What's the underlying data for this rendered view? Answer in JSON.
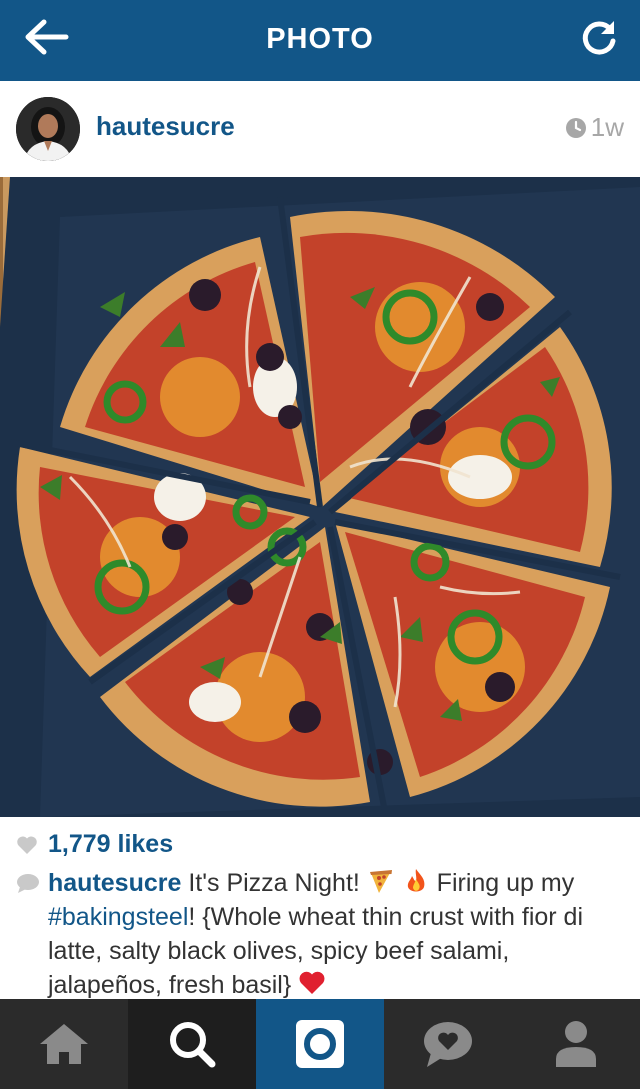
{
  "app": {
    "screen_title": "PHOTO",
    "colors": {
      "brand_blue": "#125688",
      "tabbar": "#2b2b2b",
      "muted": "#a7a7a7"
    }
  },
  "icons": {
    "back": "arrow-left-icon",
    "refresh": "refresh-icon",
    "clock": "clock-icon",
    "like": "heart-icon",
    "comment": "comment-bubble-icon",
    "tabs": [
      "home-icon",
      "search-icon",
      "camera-icon",
      "activity-icon",
      "profile-icon"
    ]
  },
  "post": {
    "username": "hautesucre",
    "time_ago": "1w",
    "likes": "1,779 likes",
    "caption": {
      "user": "hautesucre",
      "part1": " It's Pizza Night! ",
      "part2": " Firing up my ",
      "hashtag": "#bakingsteel",
      "part3": "! {Whole wheat thin crust with fior di latte, salty black olives, spicy beef salami, jalapeños, fresh basil} "
    }
  }
}
